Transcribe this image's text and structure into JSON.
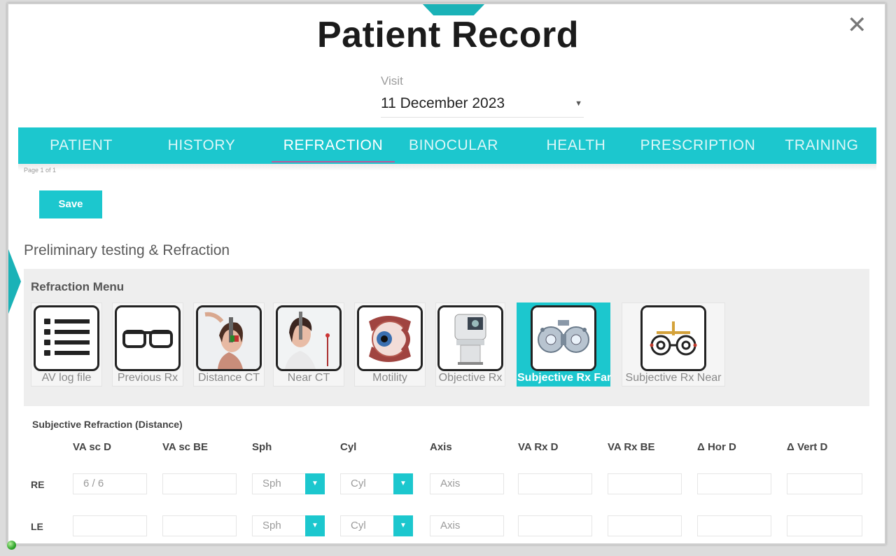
{
  "title": "Patient Record",
  "visit": {
    "label": "Visit",
    "value": "11 December 2023"
  },
  "tabs": [
    {
      "label": "PATIENT",
      "active": false
    },
    {
      "label": "HISTORY",
      "active": false
    },
    {
      "label": "REFRACTION",
      "active": true
    },
    {
      "label": "BINOCULAR",
      "active": false
    },
    {
      "label": "HEALTH",
      "active": false
    },
    {
      "label": "PRESCRIPTION",
      "active": false
    },
    {
      "label": "TRAINING",
      "active": false
    }
  ],
  "page_info": "Page 1 of 1",
  "save_label": "Save",
  "section_title": "Preliminary testing & Refraction",
  "refraction_menu": {
    "title": "Refraction Menu",
    "items": [
      {
        "label": "AV log file",
        "icon": "list-icon"
      },
      {
        "label": "Previous Rx",
        "icon": "glasses-icon"
      },
      {
        "label": "Distance CT",
        "icon": "cover-test-photo"
      },
      {
        "label": "Near CT",
        "icon": "near-test-photo"
      },
      {
        "label": "Motility",
        "icon": "eye-anatomy-icon"
      },
      {
        "label": "Objective Rx",
        "icon": "autorefractor-icon"
      },
      {
        "label": "Subjective Rx Far",
        "icon": "phoropter-icon",
        "selected": true
      },
      {
        "label": "Subjective Rx Near",
        "icon": "phoropter-near-icon"
      }
    ]
  },
  "subjective": {
    "title": "Subjective Refraction (Distance)",
    "headers": [
      "VA sc D",
      "VA sc BE",
      "Sph",
      "Cyl",
      "Axis",
      "VA Rx D",
      "VA Rx BE",
      "Δ Hor D",
      "Δ Vert D"
    ],
    "rows": [
      {
        "label": "RE",
        "va_sc_d": "6 / 6",
        "sph": "Sph",
        "cyl": "Cyl",
        "axis": "Axis"
      },
      {
        "label": "LE",
        "va_sc_d": "",
        "sph": "Sph",
        "cyl": "Cyl",
        "axis": "Axis"
      }
    ]
  },
  "colors": {
    "accent": "#1cc7ce",
    "active_underline": "#c0579b"
  }
}
